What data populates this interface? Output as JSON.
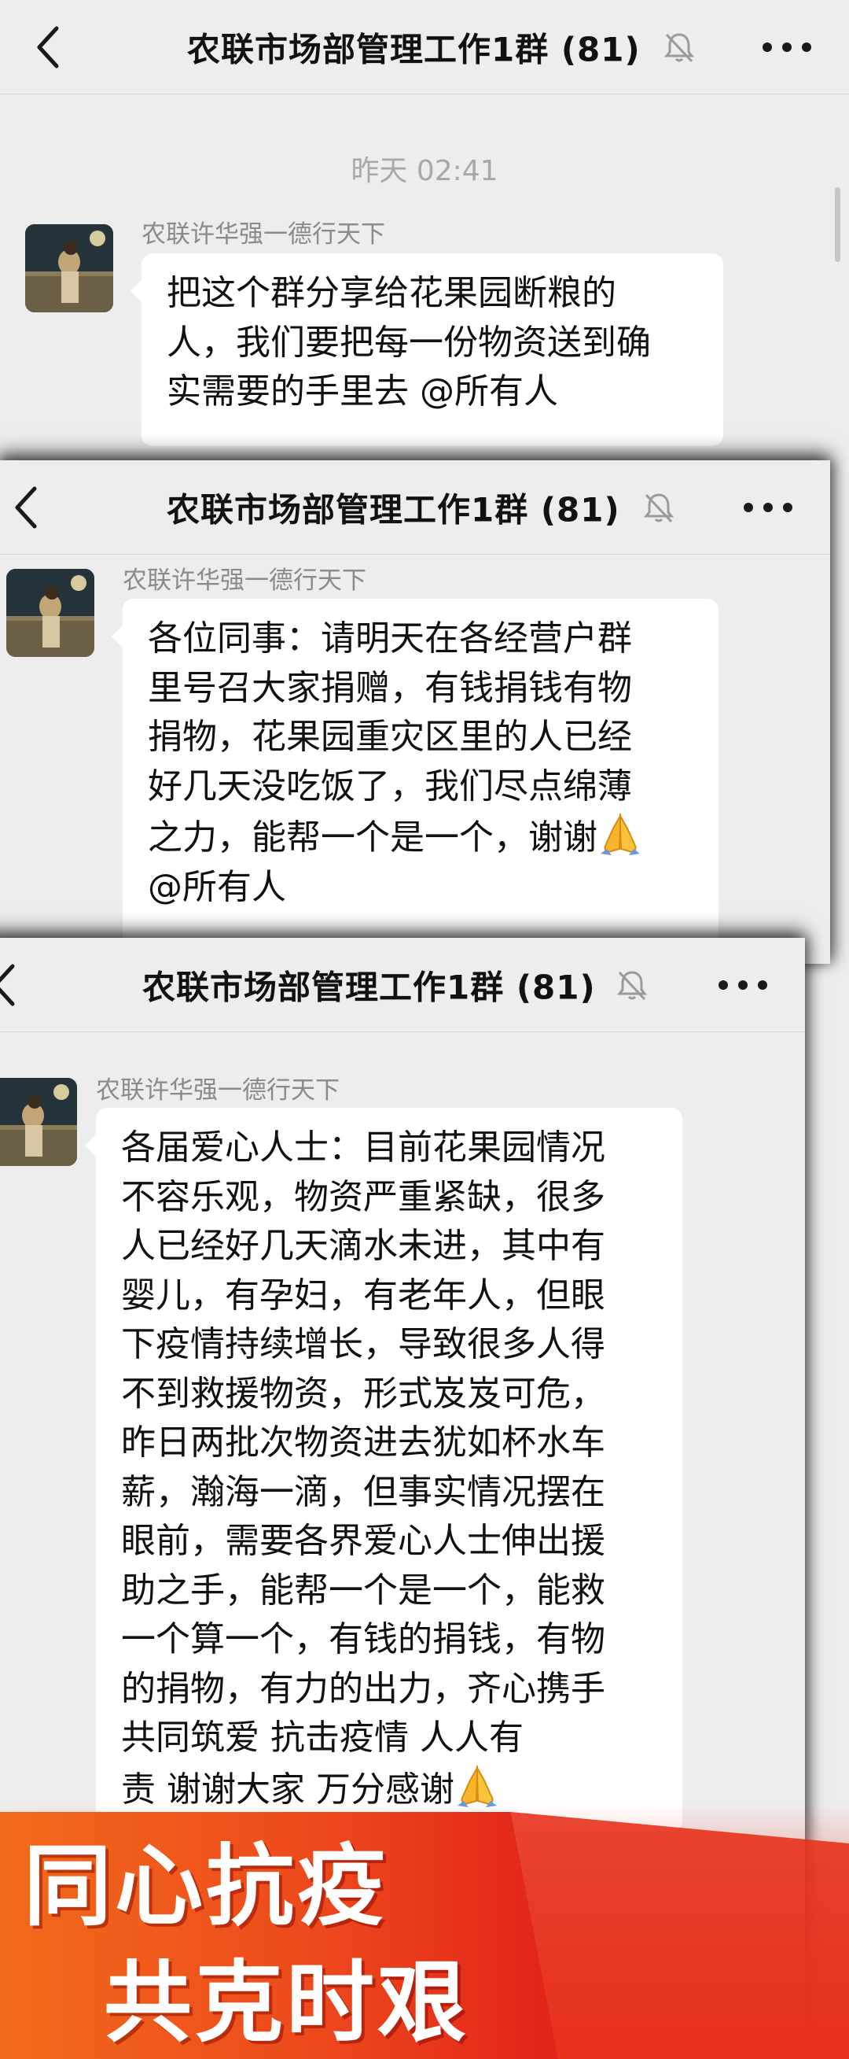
{
  "screens": [
    {
      "title": "农联市场部管理工作1群 (81)",
      "timestamp": "昨天 02:41",
      "sender": "农联许华强一德行天下",
      "message_lines": [
        "把这个群分享给花果园断粮的",
        "人，我们要把每一份物资送到确",
        "实需要的手里去 @所有人"
      ]
    },
    {
      "title": "农联市场部管理工作1群 (81)",
      "sender": "农联许华强一德行天下",
      "message_lines": [
        "各位同事：请明天在各经营户群",
        "里号召大家捐赠，有钱捐钱有物",
        "捐物，花果园重灾区里的人已经",
        "好几天没吃饭了，我们尽点绵薄",
        "之力，能帮一个是一个，谢谢",
        "@所有人"
      ]
    },
    {
      "title": "农联市场部管理工作1群 (81)",
      "sender": "农联许华强一德行天下",
      "message_lines": [
        "各届爱心人士：目前花果园情况",
        "不容乐观，物资严重紧缺，很多",
        "人已经好几天滴水未进，其中有",
        "婴儿，有孕妇，有老年人，但眼",
        "下疫情持续增长，导致很多人得",
        "不到救援物资，形式岌岌可危，",
        "昨日两批次物资进去犹如杯水车",
        "薪，瀚海一滴，但事实情况摆在",
        "眼前，需要各界爱心人士伸出援",
        "助之手，能帮一个是一个，能救",
        "一个算一个，有钱的捐钱，有物",
        "的捐物，有力的出力，齐心携手",
        "  共同筑爱   抗击疫情    人人有",
        "责   谢谢大家   万分感谢"
      ]
    }
  ],
  "icons": {
    "back": "chevron-left-icon",
    "mute": "bell-off-icon",
    "more": "more-dots-icon",
    "pray": "folded-hands-emoji"
  },
  "banner": {
    "line1": "同心抗疫",
    "line2": "共克时艰"
  },
  "colors": {
    "chat_bg": "#ededed",
    "bubble": "#ffffff",
    "banner_red": "#e8311c",
    "banner_orange": "#f26a1b"
  }
}
